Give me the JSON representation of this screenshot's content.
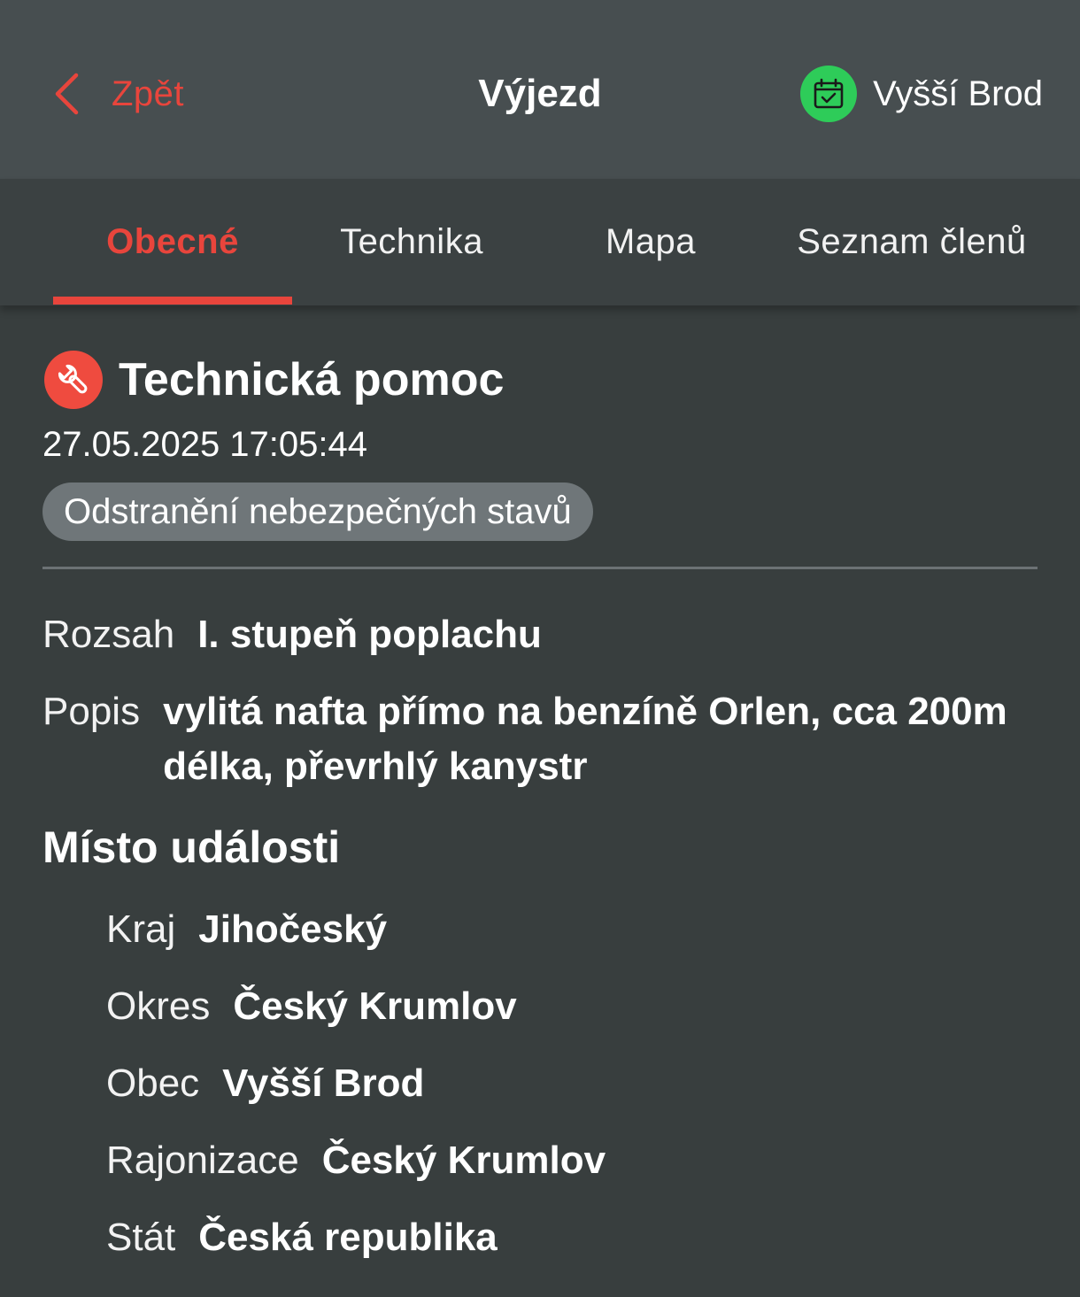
{
  "header": {
    "back_label": "Zpět",
    "title": "Výjezd",
    "station_name": "Vyšší Brod"
  },
  "tabs": [
    {
      "label": "Obecné",
      "active": true
    },
    {
      "label": "Technika",
      "active": false
    },
    {
      "label": "Mapa",
      "active": false
    },
    {
      "label": "Seznam členů",
      "active": false
    }
  ],
  "incident": {
    "type_icon": "wrench-icon",
    "type": "Technická pomoc",
    "datetime": "27.05.2025 17:05:44",
    "subtype": "Odstranění nebezpečných stavů",
    "fields": [
      {
        "label": "Rozsah",
        "value": "I. stupeň poplachu"
      },
      {
        "label": "Popis",
        "value": "vylitá nafta přímo na benzíně Orlen, cca 200m délka, převrhlý kanystr"
      }
    ]
  },
  "location": {
    "title": "Místo události",
    "fields": [
      {
        "label": "Kraj",
        "value": "Jihočeský"
      },
      {
        "label": "Okres",
        "value": "Český Krumlov"
      },
      {
        "label": "Obec",
        "value": "Vyšší Brod"
      },
      {
        "label": "Rajonizace",
        "value": "Český Krumlov"
      },
      {
        "label": "Stát",
        "value": "Česká republika"
      }
    ]
  },
  "colors": {
    "accent": "#e8453c",
    "header_bg": "#474e50",
    "page_bg": "#383e3e",
    "station_badge": "#2ecc59",
    "chip_bg": "#6f7679"
  }
}
